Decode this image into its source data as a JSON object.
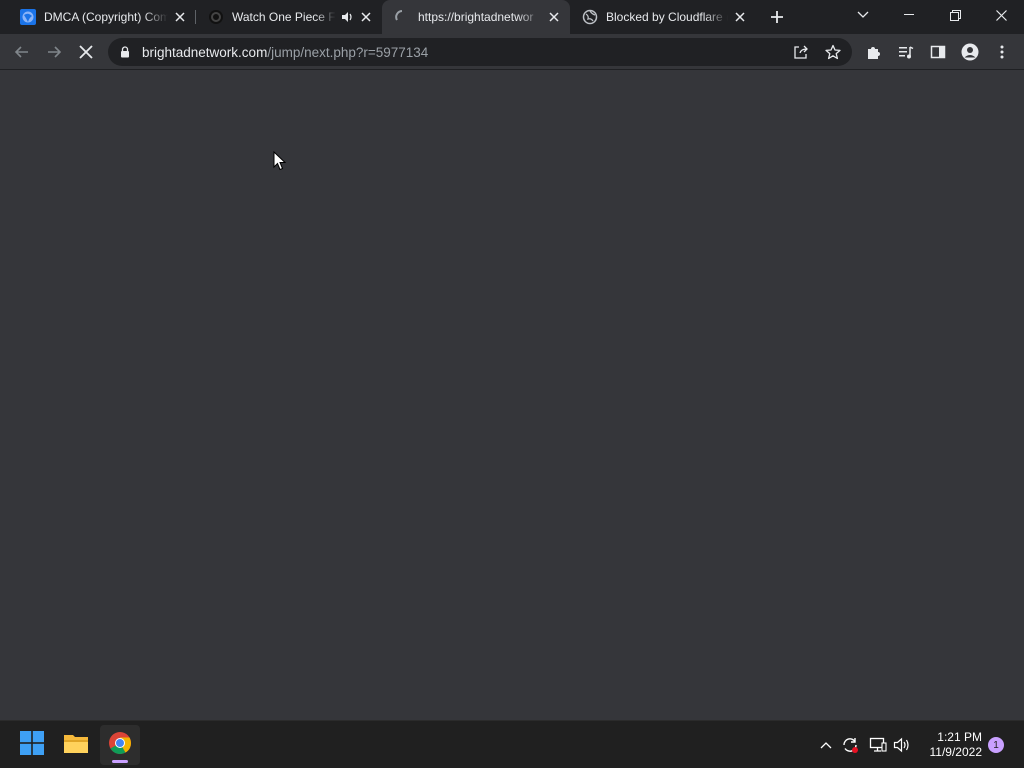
{
  "browser": {
    "tabs": [
      {
        "title": "DMCA (Copyright) Com",
        "favicon": "globe-blue-icon",
        "active": false
      },
      {
        "title": "Watch One Piece F",
        "favicon": "dark-circle-icon",
        "audio": true,
        "active": false
      },
      {
        "title": "https://brightadnetwor",
        "favicon": "loading-spinner-icon",
        "active": true
      },
      {
        "title": "Blocked by Cloudflare (",
        "favicon": "globe-gray-icon",
        "active": false
      }
    ],
    "address": {
      "host": "brightadnetwork.com",
      "path": "/jump/next.php?r=5977134"
    }
  },
  "taskbar": {
    "apps": [
      {
        "name": "start-menu",
        "icon": "windows-logo-icon"
      },
      {
        "name": "file-explorer",
        "icon": "folder-icon"
      },
      {
        "name": "google-chrome",
        "icon": "chrome-icon",
        "active": true
      }
    ],
    "clock": {
      "time": "1:21 PM",
      "date": "11/9/2022"
    },
    "notification_count": "1"
  },
  "colors": {
    "tabstrip": "#202124",
    "toolbar": "#35363a",
    "omnibox": "#202124",
    "taskbar": "#202020",
    "accent": "#c9a0ff"
  }
}
